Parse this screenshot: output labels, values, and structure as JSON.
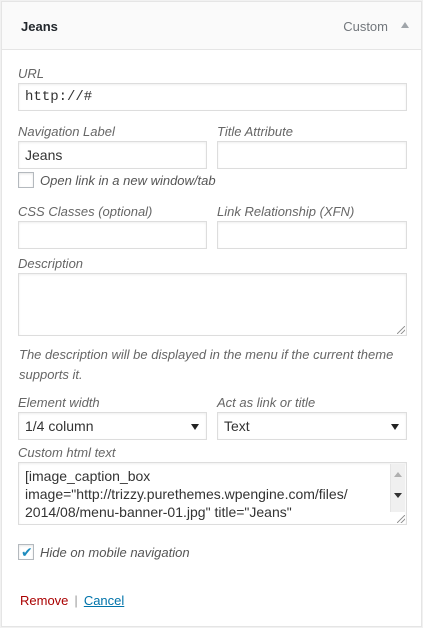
{
  "header": {
    "title": "Jeans",
    "type": "Custom"
  },
  "fields": {
    "url": {
      "label": "URL",
      "value": "http://#"
    },
    "nav_label": {
      "label": "Navigation Label",
      "value": "Jeans"
    },
    "title_attr": {
      "label": "Title Attribute",
      "value": ""
    },
    "new_window": {
      "label": "Open link in a new window/tab",
      "checked": false
    },
    "css_classes": {
      "label": "CSS Classes (optional)",
      "value": ""
    },
    "link_rel": {
      "label": "Link Relationship (XFN)",
      "value": ""
    },
    "description": {
      "label": "Description",
      "value": "",
      "help": "The description will be displayed in the menu if the current theme supports it."
    },
    "element_width": {
      "label": "Element width",
      "selected": "1/4 column"
    },
    "act_as": {
      "label": "Act as link or title",
      "selected": "Text"
    },
    "custom_html": {
      "label": "Custom html text",
      "line1": "[image_caption_box",
      "line2": "image=\"http://trizzy.purethemes.wpengine.com/files/",
      "line3": "2014/08/menu-banner-01.jpg\" title=\"Jeans\""
    },
    "hide_mobile": {
      "label": "Hide on mobile navigation",
      "checked": true
    }
  },
  "actions": {
    "remove": "Remove",
    "separator": "|",
    "cancel": "Cancel"
  },
  "colors": {
    "link": "#0073aa",
    "remove": "#aa0000",
    "check": "#1e8cbe"
  },
  "icons": {
    "toggle": "triangle-up-icon",
    "check": "checkmark-icon"
  }
}
